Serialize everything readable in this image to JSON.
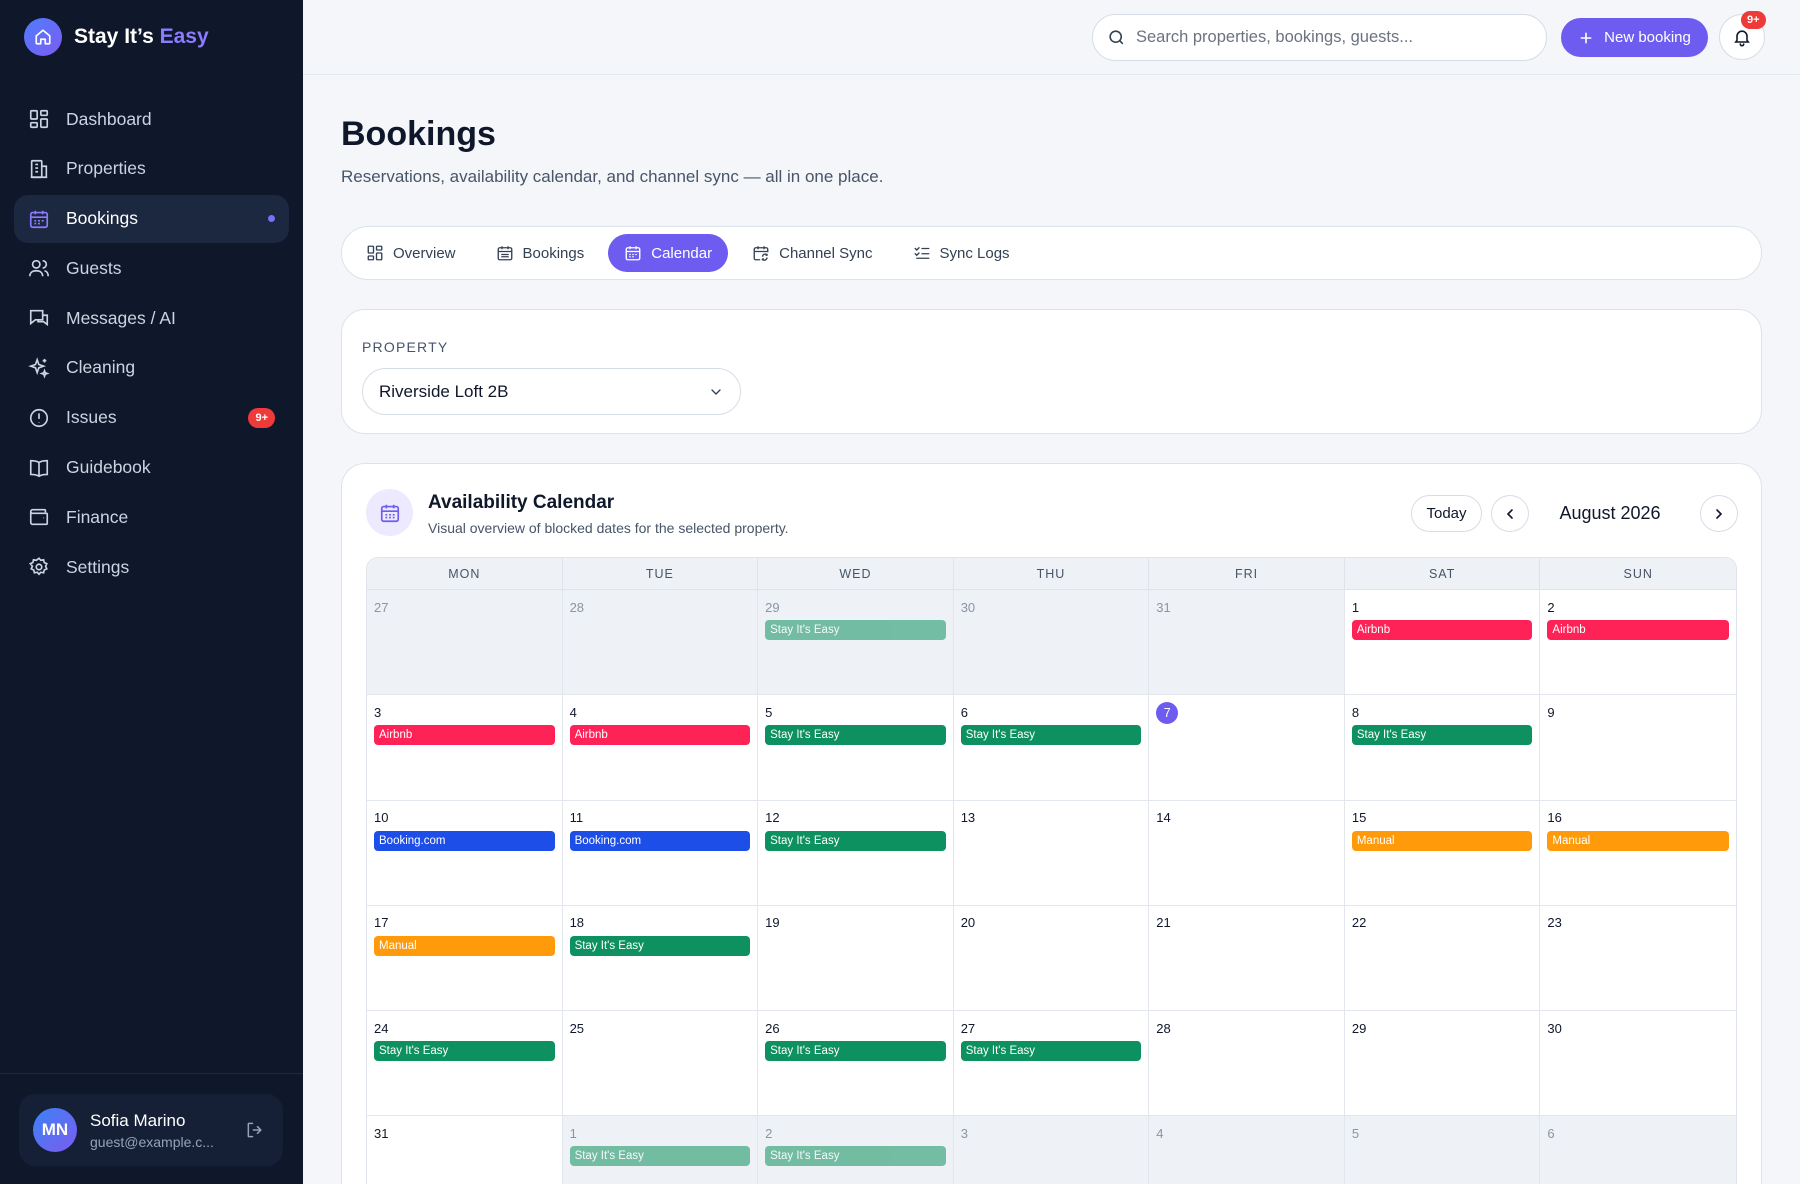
{
  "app": {
    "brand_main": "Stay It’s ",
    "brand_accent": "Easy"
  },
  "sidebar": {
    "items": [
      {
        "label": "Dashboard",
        "icon": "dashboard-icon"
      },
      {
        "label": "Properties",
        "icon": "building-icon"
      },
      {
        "label": "Bookings",
        "icon": "calendar-icon",
        "active": true
      },
      {
        "label": "Guests",
        "icon": "users-icon"
      },
      {
        "label": "Messages / AI",
        "icon": "messages-icon"
      },
      {
        "label": "Cleaning",
        "icon": "sparkles-icon"
      },
      {
        "label": "Issues",
        "icon": "alert-circle-icon",
        "badge": "9+"
      },
      {
        "label": "Guidebook",
        "icon": "book-icon"
      },
      {
        "label": "Finance",
        "icon": "wallet-icon"
      },
      {
        "label": "Settings",
        "icon": "gear-icon"
      }
    ],
    "user": {
      "initials": "MN",
      "name": "Sofia Marino",
      "email": "guest@example.c..."
    }
  },
  "topbar": {
    "search_placeholder": "Search properties, bookings, guests...",
    "new_booking_label": "New booking",
    "notification_badge": "9+"
  },
  "page": {
    "title": "Bookings",
    "subtitle": "Reservations, availability calendar, and channel sync — all in one place."
  },
  "tabs": [
    {
      "label": "Overview",
      "icon": "grid-icon"
    },
    {
      "label": "Bookings",
      "icon": "calendar-list-icon"
    },
    {
      "label": "Calendar",
      "icon": "calendar-icon",
      "active": true
    },
    {
      "label": "Channel Sync",
      "icon": "calendar-sync-icon"
    },
    {
      "label": "Sync Logs",
      "icon": "list-checks-icon"
    }
  ],
  "property": {
    "label": "PROPERTY",
    "selected": "Riverside Loft 2B"
  },
  "calendar": {
    "title": "Availability Calendar",
    "subtitle": "Visual overview of blocked dates for the selected property.",
    "today_label": "Today",
    "month": "August 2026",
    "weekdays": [
      "MON",
      "TUE",
      "WED",
      "THU",
      "FRI",
      "SAT",
      "SUN"
    ],
    "channel_colors": {
      "Stay It's Easy": "#0e9160",
      "Airbnb": "#ff2257",
      "Booking.com": "#1d4ee8",
      "Manual": "#ff9a0b"
    },
    "days": [
      {
        "num": "27",
        "out": true
      },
      {
        "num": "28",
        "out": true
      },
      {
        "num": "29",
        "out": true,
        "event": "Stay It's Easy"
      },
      {
        "num": "30",
        "out": true
      },
      {
        "num": "31",
        "out": true
      },
      {
        "num": "1",
        "event": "Airbnb"
      },
      {
        "num": "2",
        "event": "Airbnb"
      },
      {
        "num": "3",
        "event": "Airbnb"
      },
      {
        "num": "4",
        "event": "Airbnb"
      },
      {
        "num": "5",
        "event": "Stay It's Easy"
      },
      {
        "num": "6",
        "event": "Stay It's Easy"
      },
      {
        "num": "7",
        "today": true
      },
      {
        "num": "8",
        "event": "Stay It's Easy"
      },
      {
        "num": "9"
      },
      {
        "num": "10",
        "event": "Booking.com"
      },
      {
        "num": "11",
        "event": "Booking.com"
      },
      {
        "num": "12",
        "event": "Stay It's Easy"
      },
      {
        "num": "13"
      },
      {
        "num": "14"
      },
      {
        "num": "15",
        "event": "Manual"
      },
      {
        "num": "16",
        "event": "Manual"
      },
      {
        "num": "17",
        "event": "Manual"
      },
      {
        "num": "18",
        "event": "Stay It's Easy"
      },
      {
        "num": "19"
      },
      {
        "num": "20"
      },
      {
        "num": "21"
      },
      {
        "num": "22"
      },
      {
        "num": "23"
      },
      {
        "num": "24",
        "event": "Stay It's Easy"
      },
      {
        "num": "25"
      },
      {
        "num": "26",
        "event": "Stay It's Easy"
      },
      {
        "num": "27",
        "event": "Stay It's Easy"
      },
      {
        "num": "28"
      },
      {
        "num": "29"
      },
      {
        "num": "30"
      },
      {
        "num": "31"
      },
      {
        "num": "1",
        "out": true,
        "event": "Stay It's Easy"
      },
      {
        "num": "2",
        "out": true,
        "event": "Stay It's Easy"
      },
      {
        "num": "3",
        "out": true
      },
      {
        "num": "4",
        "out": true
      },
      {
        "num": "5",
        "out": true
      },
      {
        "num": "6",
        "out": true
      }
    ]
  }
}
